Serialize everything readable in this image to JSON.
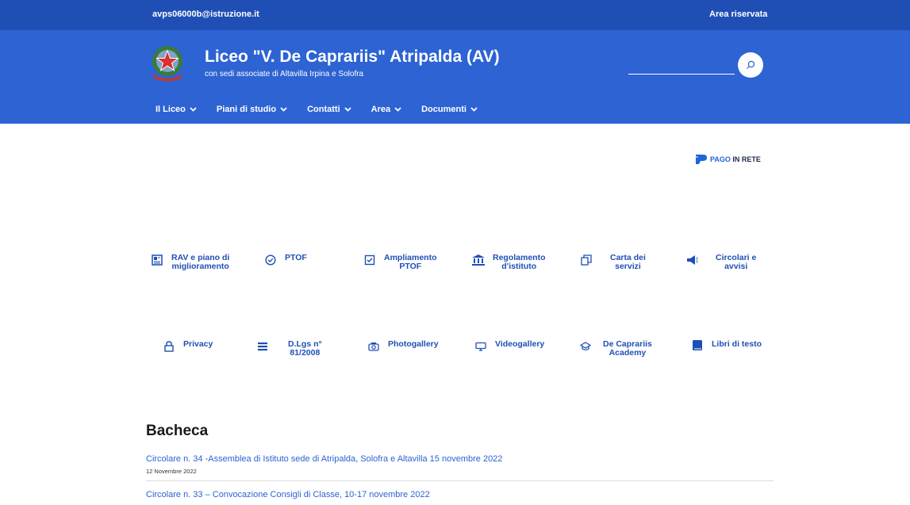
{
  "topbar": {
    "email": "avps06000b@istruzione.it",
    "reserved_area": "Area riservata"
  },
  "header": {
    "title": "Liceo \"V. De Caprariis\" Atripalda (AV)",
    "subtitle": "con sedi associate di Altavilla Irpina e Solofra",
    "search_placeholder": ""
  },
  "nav": [
    "Il Liceo",
    "Piani di studio",
    "Contatti",
    "Area",
    "Documenti"
  ],
  "pago": {
    "part1": "PAGO",
    "part2": " IN RETE"
  },
  "quicklinks": {
    "rav": [
      "RAV e piano di",
      "miglioramento"
    ],
    "ptof": [
      "PTOF"
    ],
    "ampliamento": [
      "Ampliamento",
      "PTOF"
    ],
    "regolamento": [
      "Regolamento",
      "d'istituto"
    ],
    "carta": [
      "Carta dei",
      "servizi"
    ],
    "circolari": [
      "Circolari e",
      "avvisi"
    ],
    "privacy": [
      "Privacy"
    ],
    "dlgs": [
      "D.Lgs n°",
      "81/2008"
    ],
    "photo": [
      "Photogallery"
    ],
    "video": [
      "Videogallery"
    ],
    "academy": [
      "De Caprariis",
      "Academy"
    ],
    "libri": [
      "Libri di testo"
    ]
  },
  "bacheca": {
    "title": "Bacheca",
    "posts": [
      {
        "title": "Circolare n. 34 -Assemblea di Istituto sede di Atripalda, Solofra e Altavilla 15 novembre 2022",
        "date": "12 Novembre 2022"
      },
      {
        "title": "Circolare n. 33 – Convocazione Consigli di Classe, 10-17 novembre 2022",
        "date": ""
      }
    ]
  },
  "colors": {
    "topbar": "#1f4fb5",
    "header": "#2d63d3",
    "link": "#1f4fb5"
  }
}
